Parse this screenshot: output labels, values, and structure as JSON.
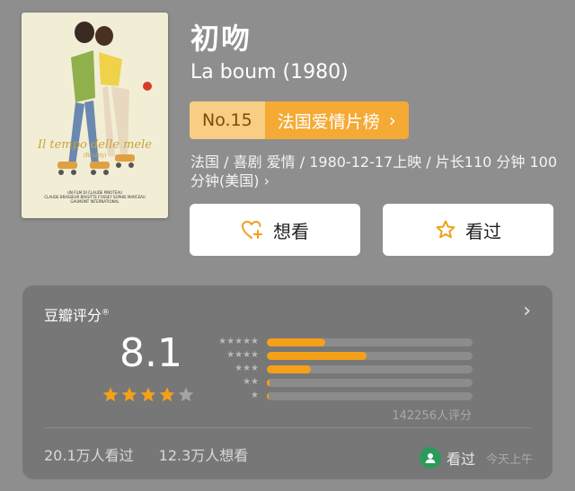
{
  "movie": {
    "title_cn": "初吻",
    "title_en": "La boum (1980)"
  },
  "poster": {
    "title": "Il tempo delle mele",
    "subtitle": "(Reality)",
    "credits": [
      "UN FILM DI CLAUDE PINOTEAU",
      "CLAUDE BRASSEUR  BRIGITTE FOSSEY  SOPHIE MARCEAU",
      "GAUMONT INTERNATIONAL"
    ]
  },
  "rank": {
    "number": "No.15",
    "list": "法国爱情片榜",
    "chevron": "›"
  },
  "meta": {
    "text": "法国 / 喜剧 爱情 / 1980-12-17上映 / 片长110 分钟 100 分钟(美国) ›"
  },
  "actions": {
    "want_label": "想看",
    "seen_label": "看过"
  },
  "rating": {
    "header": "豆瓣评分",
    "registered": "®",
    "chevron": "›",
    "score": "8.1",
    "stars_filled": 4,
    "stars_total": 5,
    "distribution_percent": [
      28.5,
      48.5,
      21.5,
      1.1,
      0.4
    ],
    "votes": "142256人评分",
    "seen_count": "20.1万人看过",
    "want_count": "12.3万人想看",
    "my_status": "看过",
    "my_time": "今天上午"
  },
  "colors": {
    "accent": "#f4a019",
    "rank_left": "#f7ce83",
    "rank_right": "#f4aa35",
    "card_bg": "#777777",
    "page_bg": "#8e8e8e"
  },
  "icons": {
    "want": "heart-plus-icon",
    "seen": "star-outline-icon",
    "avatar": "user-avatar-icon"
  }
}
